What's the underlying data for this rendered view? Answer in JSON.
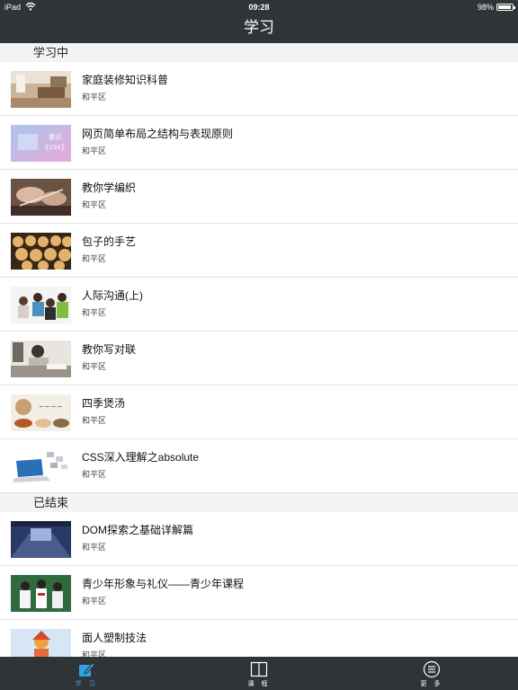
{
  "status_bar": {
    "carrier": "iPad",
    "time": "09:28",
    "battery": "98%"
  },
  "nav": {
    "title": "学习"
  },
  "sections": [
    {
      "header": "学习中",
      "items": [
        {
          "title": "家庭装修知识科普",
          "subtitle": "和平区",
          "thumb": "interior-room-photo"
        },
        {
          "title": "网页简单布局之结构与表现原则",
          "subtitle": "和平区",
          "thumb": "css-banner"
        },
        {
          "title": "教你学编织",
          "subtitle": "和平区",
          "thumb": "knitting-photo"
        },
        {
          "title": "包子的手艺",
          "subtitle": "和平区",
          "thumb": "steamed-buns-photo"
        },
        {
          "title": "人际沟通(上)",
          "subtitle": "和平区",
          "thumb": "people-talking-photo"
        },
        {
          "title": "教你写对联",
          "subtitle": "和平区",
          "thumb": "calligraphy-photo"
        },
        {
          "title": "四季煲汤",
          "subtitle": "和平区",
          "thumb": "soup-photo"
        },
        {
          "title": "CSS深入理解之absolute",
          "subtitle": "和平区",
          "thumb": "laptop-photo"
        }
      ]
    },
    {
      "header": "已结束",
      "items": [
        {
          "title": "DOM探索之基础详解篇",
          "subtitle": "和平区",
          "thumb": "hall-photo"
        },
        {
          "title": "青少年形象与礼仪——青少年课程",
          "subtitle": "和平区",
          "thumb": "students-photo"
        },
        {
          "title": "面人塑制技法",
          "subtitle": "和平区",
          "thumb": "dough-figure-photo"
        }
      ]
    }
  ],
  "tabs": [
    {
      "label": "学 习",
      "icon": "edit-icon",
      "active": true
    },
    {
      "label": "课 程",
      "icon": "book-icon",
      "active": false
    },
    {
      "label": "更 多",
      "icon": "menu-circle-icon",
      "active": false
    }
  ],
  "colors": {
    "bar": "#2f3536",
    "active_tab": "#2fa3e6",
    "inactive_tab": "#ffffff"
  }
}
